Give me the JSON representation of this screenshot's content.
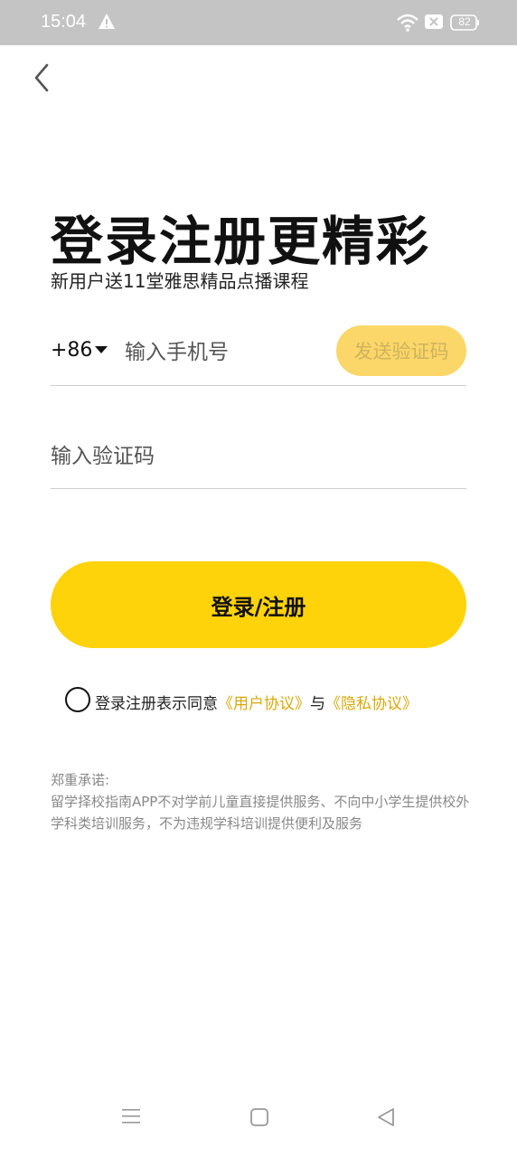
{
  "status_bar": {
    "time": "15:04",
    "battery": "82",
    "icons": [
      "warning-icon",
      "wifi-icon",
      "sim-icon",
      "battery-icon"
    ]
  },
  "header": {
    "back_icon": "chevron-left-icon"
  },
  "title": "登录注册更精彩",
  "subtitle": "新用户送11堂雅思精品点播课程",
  "phone": {
    "country_code": "+86",
    "placeholder": "输入手机号",
    "send_code_label": "发送验证码"
  },
  "code": {
    "placeholder": "输入验证码"
  },
  "login_label": "登录/注册",
  "agreement": {
    "prefix": "登录注册表示同意",
    "user_agreement": "《用户协议》",
    "conjunction": "与",
    "privacy_policy": "《隐私协议》"
  },
  "commitment": {
    "title": "郑重承诺:",
    "body": "留学择校指南APP不对学前儿童直接提供服务、不向中小学生提供校外学科类培训服务，不为违规学科培训提供便利及服务"
  },
  "colors": {
    "primary": "#fed30a",
    "send_code_bg": "#fbd76a",
    "link": "#d9a90b",
    "status_bar": "#c4c4c4"
  }
}
